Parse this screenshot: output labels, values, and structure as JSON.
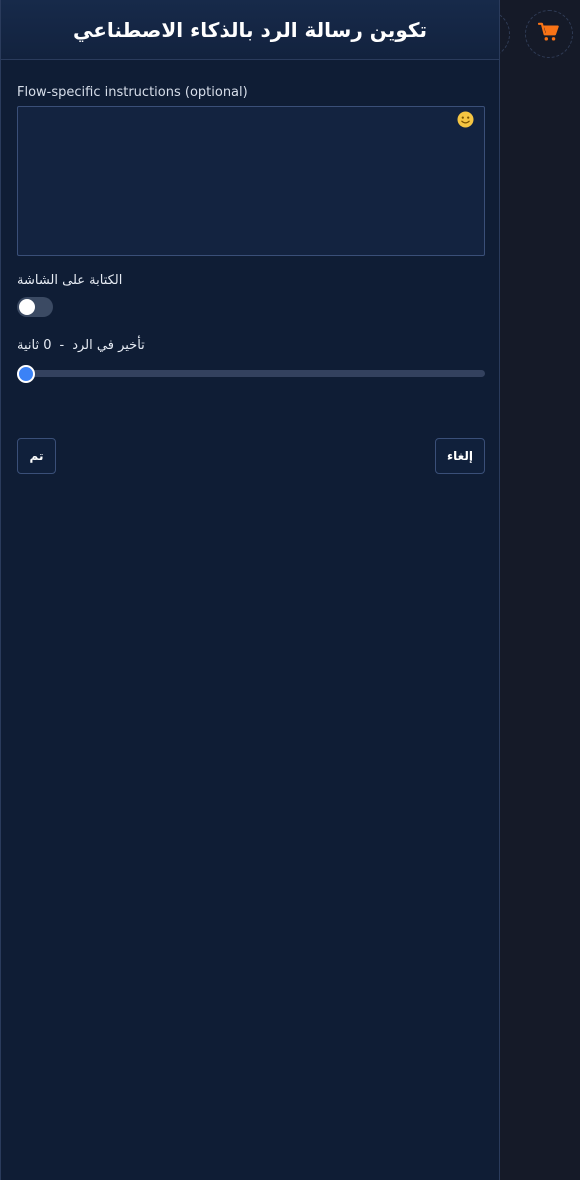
{
  "drawer": {
    "title": "تكوين رسالة الرد بالذكاء الاصطناعي"
  },
  "instructions": {
    "label": "Flow-specific instructions (optional)",
    "value": "",
    "placeholder": ""
  },
  "typing_indicator": {
    "label": "الكتابة على الشاشة",
    "enabled": false
  },
  "reply_delay": {
    "label": "تأخير في الرد",
    "separator": "-",
    "value_text": "0 ثانية",
    "value": 0
  },
  "actions": {
    "done_label": "تم",
    "cancel_label": "إلغاء"
  },
  "icons": {
    "emoji": "smiley-icon",
    "cart": "shopping-cart-icon"
  },
  "colors": {
    "panel_bg": "#0f1d35",
    "accent": "#3b82f6",
    "cart": "#f97316",
    "emoji": "#f5c542"
  }
}
